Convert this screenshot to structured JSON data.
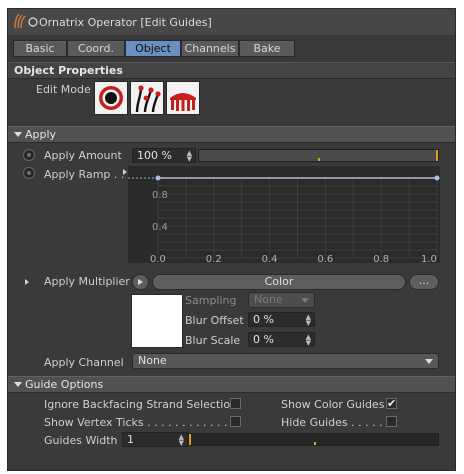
{
  "window": {
    "title": "Ornatrix Operator [Edit Guides]"
  },
  "tabs": [
    {
      "label": "Basic"
    },
    {
      "label": "Coord."
    },
    {
      "label": "Object",
      "active": true
    },
    {
      "label": "Channels"
    },
    {
      "label": "Bake"
    }
  ],
  "object_properties": {
    "header": "Object Properties",
    "edit_mode_label": "Edit Mode",
    "modes": [
      {
        "icon": "target-icon"
      },
      {
        "icon": "strand-points-icon"
      },
      {
        "icon": "comb-icon"
      }
    ]
  },
  "apply": {
    "header": "Apply",
    "amount_label": "Apply Amount",
    "amount_value": "100 %",
    "ramp_label": "Apply Ramp . .",
    "ramp_y_ticks": [
      "0.8",
      "0.4"
    ],
    "ramp_x_ticks": [
      "0.0",
      "0.2",
      "0.4",
      "0.6",
      "0.8",
      "1.0"
    ],
    "ramp_points": [
      [
        0.0,
        1.0
      ],
      [
        1.0,
        1.0
      ]
    ],
    "multiplier_label": "Apply Multiplier",
    "multiplier_type": "Color",
    "more_button": "...",
    "sampling_label": "Sampling",
    "sampling_value": "None",
    "blur_offset_label": "Blur Offset",
    "blur_offset_value": "0 %",
    "blur_scale_label": "Blur Scale",
    "blur_scale_value": "0 %",
    "swatch_color": "#ffffff",
    "channel_label": "Apply Channel",
    "channel_value": "None"
  },
  "guide_options": {
    "header": "Guide Options",
    "ignore_backfacing_label": "Ignore Backfacing Strand Selection",
    "ignore_backfacing": false,
    "show_color_guides_label": "Show Color Guides",
    "show_color_guides": true,
    "show_vertex_ticks_label": "Show Vertex Ticks . . . . . . . . . . . . . .",
    "show_vertex_ticks": false,
    "hide_guides_label": "Hide Guides . . . . .",
    "hide_guides": false,
    "guides_width_label": "Guides Width",
    "guides_width_value": "1",
    "check_glyph": "✔"
  },
  "colors": {
    "accent": "#6b8fc0",
    "slider_marker": "#e0a020",
    "panel": "#3a3a3a"
  }
}
